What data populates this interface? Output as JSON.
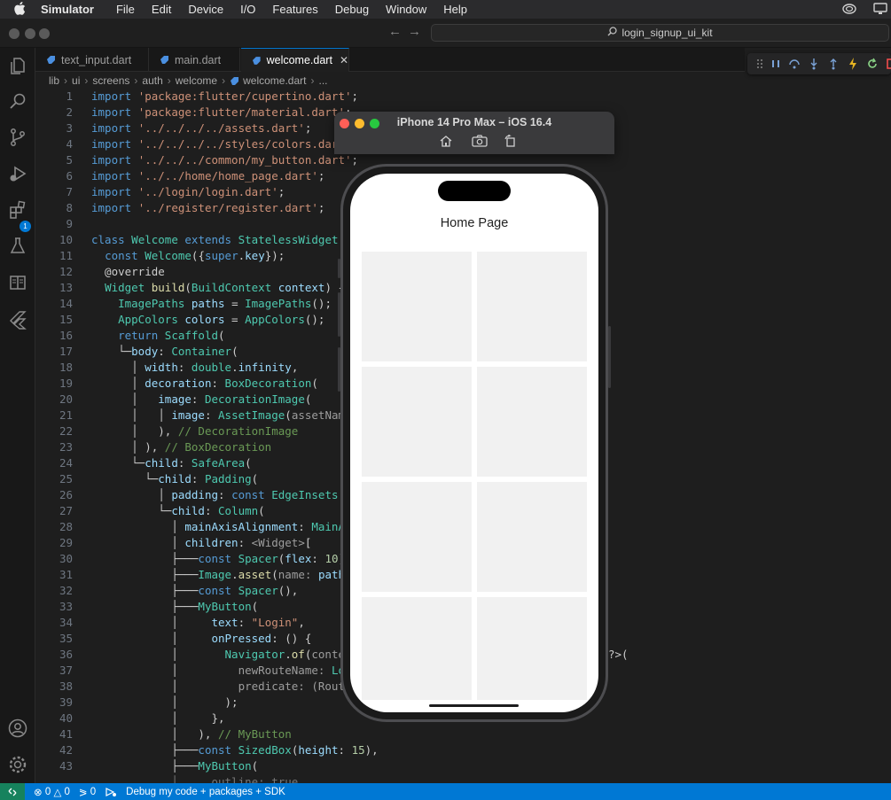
{
  "menubar": {
    "app": "Simulator",
    "items": [
      "File",
      "Edit",
      "Device",
      "I/O",
      "Features",
      "Debug",
      "Window",
      "Help"
    ]
  },
  "command_center": {
    "text": "login_signup_ui_kit"
  },
  "tabs": [
    {
      "label": "text_input.dart"
    },
    {
      "label": "main.dart"
    },
    {
      "label": "welcome.dart"
    }
  ],
  "breadcrumb": [
    "lib",
    "ui",
    "screens",
    "auth",
    "welcome",
    "welcome.dart",
    "..."
  ],
  "activity_badge": "1",
  "editor_lines": [
    "1",
    "2",
    "3",
    "4",
    "5",
    "6",
    "7",
    "8",
    "9",
    "10",
    "11",
    "12",
    "13",
    "14",
    "15",
    "16",
    "17",
    "18",
    "19",
    "20",
    "21",
    "22",
    "23",
    "24",
    "25",
    "26",
    "27",
    "28",
    "29",
    "30",
    "31",
    "32",
    "33",
    "34",
    "35",
    "36",
    "37",
    "38",
    "39",
    "40",
    "41",
    "42",
    "43"
  ],
  "overflow_text": "?>(",
  "simulator": {
    "title": "iPhone 14 Pro Max – iOS 16.4",
    "screen_title": "Home Page"
  },
  "status": {
    "errors": "0",
    "warnings": "0",
    "ports": "0",
    "debug_label": "Debug my code + packages + SDK"
  },
  "colors": {
    "accent": "#0078d4",
    "remote": "#16825d"
  }
}
